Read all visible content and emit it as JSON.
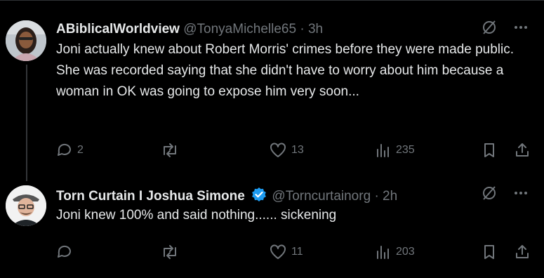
{
  "posts": [
    {
      "display_name": "ABiblicalWorldview",
      "handle": "@TonyaMichelle65",
      "separator": "·",
      "time": "3h",
      "verified": false,
      "text": "Joni actually knew about Robert Morris' crimes before they were made public. She was recorded saying that she didn't have to worry about him because a woman in OK was going to expose him very soon...",
      "replies": "2",
      "reposts": "",
      "likes": "13",
      "views": "235"
    },
    {
      "display_name": "Torn Curtain I Joshua Simone",
      "handle": "@Torncurtainorg",
      "separator": "·",
      "time": "2h",
      "verified": true,
      "text": "Joni knew 100% and said nothing...... sickening",
      "replies": "",
      "reposts": "",
      "likes": "11",
      "views": "203"
    }
  ],
  "colors": {
    "background": "#000000",
    "text": "#e7e9ea",
    "muted": "#71767b",
    "verified": "#1d9bf0",
    "divider": "#2f3336"
  },
  "icons": [
    "grok-slash-icon",
    "more-icon",
    "reply-icon",
    "repost-icon",
    "like-icon",
    "views-icon",
    "bookmark-icon",
    "share-icon",
    "verified-badge-icon"
  ]
}
